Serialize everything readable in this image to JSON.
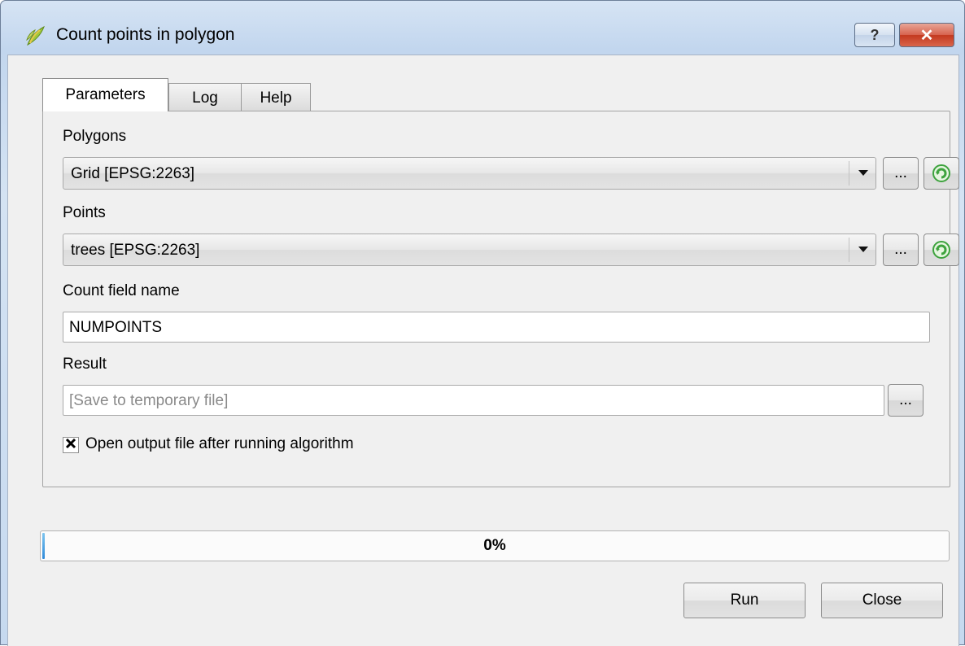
{
  "window": {
    "title": "Count points in polygon",
    "help_label": "?",
    "close_label": "✕"
  },
  "tabs": [
    {
      "label": "Parameters"
    },
    {
      "label": "Log"
    },
    {
      "label": "Help"
    }
  ],
  "parameters": {
    "polygons": {
      "label": "Polygons",
      "value": "Grid [EPSG:2263]",
      "browse_label": "..."
    },
    "points": {
      "label": "Points",
      "value": "trees [EPSG:2263]",
      "browse_label": "..."
    },
    "count_field": {
      "label": "Count field name",
      "value": "NUMPOINTS"
    },
    "result": {
      "label": "Result",
      "placeholder": "[Save to temporary file]",
      "browse_label": "..."
    },
    "open_output": {
      "label": "Open output file after running algorithm",
      "checked": true
    }
  },
  "progress": {
    "value": 0,
    "text": "0%"
  },
  "buttons": {
    "run_label": "Run",
    "close_label": "Close"
  },
  "colors": {
    "refresh_icon": "#3ea33e",
    "progress_fill": "#2f8ad9"
  },
  "icons": {
    "app": "qgis-icon",
    "refresh": "refresh-icon",
    "check": "check-icon"
  }
}
